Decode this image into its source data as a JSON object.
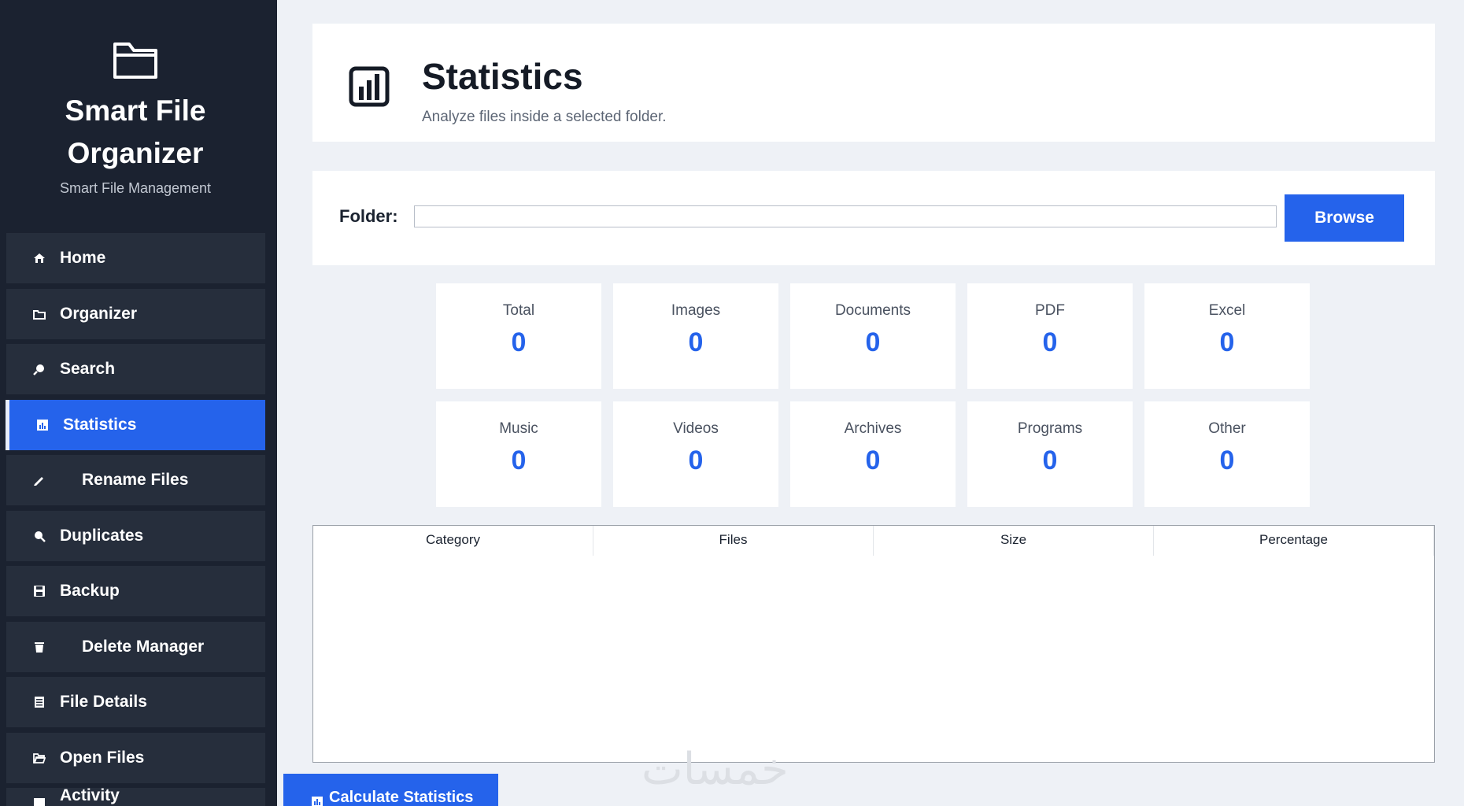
{
  "brand": {
    "icon": "folder-icon",
    "title": "Smart File Organizer",
    "subtitle": "Smart File Management"
  },
  "nav": [
    {
      "label": "Home",
      "icon": "home-icon",
      "active": false
    },
    {
      "label": "Organizer",
      "icon": "folder-icon",
      "active": false
    },
    {
      "label": "Search",
      "icon": "search-icon",
      "active": false
    },
    {
      "label": "Statistics",
      "icon": "statistics-icon",
      "active": true
    },
    {
      "label": "Rename Files",
      "icon": "rename-icon",
      "active": false
    },
    {
      "label": "Duplicates",
      "icon": "duplicates-icon",
      "active": false
    },
    {
      "label": "Backup",
      "icon": "backup-icon",
      "active": false
    },
    {
      "label": "Delete Manager",
      "icon": "trash-icon",
      "active": false
    },
    {
      "label": "File Details",
      "icon": "file-details-icon",
      "active": false
    },
    {
      "label": "Open Files",
      "icon": "open-files-icon",
      "active": false
    },
    {
      "label": "Activity",
      "icon": "activity-icon",
      "active": false
    }
  ],
  "header": {
    "icon": "bar-chart-icon",
    "title": "Statistics",
    "subtitle": "Analyze files inside a selected folder."
  },
  "folder": {
    "label": "Folder:",
    "value": "",
    "browse_label": "Browse"
  },
  "stats": [
    {
      "label": "Total",
      "value": "0"
    },
    {
      "label": "Images",
      "value": "0"
    },
    {
      "label": "Documents",
      "value": "0"
    },
    {
      "label": "PDF",
      "value": "0"
    },
    {
      "label": "Excel",
      "value": "0"
    },
    {
      "label": "Music",
      "value": "0"
    },
    {
      "label": "Videos",
      "value": "0"
    },
    {
      "label": "Archives",
      "value": "0"
    },
    {
      "label": "Programs",
      "value": "0"
    },
    {
      "label": "Other",
      "value": "0"
    }
  ],
  "table": {
    "columns": [
      "Category",
      "Files",
      "Size",
      "Percentage"
    ],
    "rows": []
  },
  "calculate_label": "Calculate Statistics",
  "watermark": "خمسات",
  "colors": {
    "sidebar_bg": "#1b2230",
    "nav_item_bg": "#262e3c",
    "accent": "#2563eb",
    "page_bg": "#eef1f6"
  }
}
